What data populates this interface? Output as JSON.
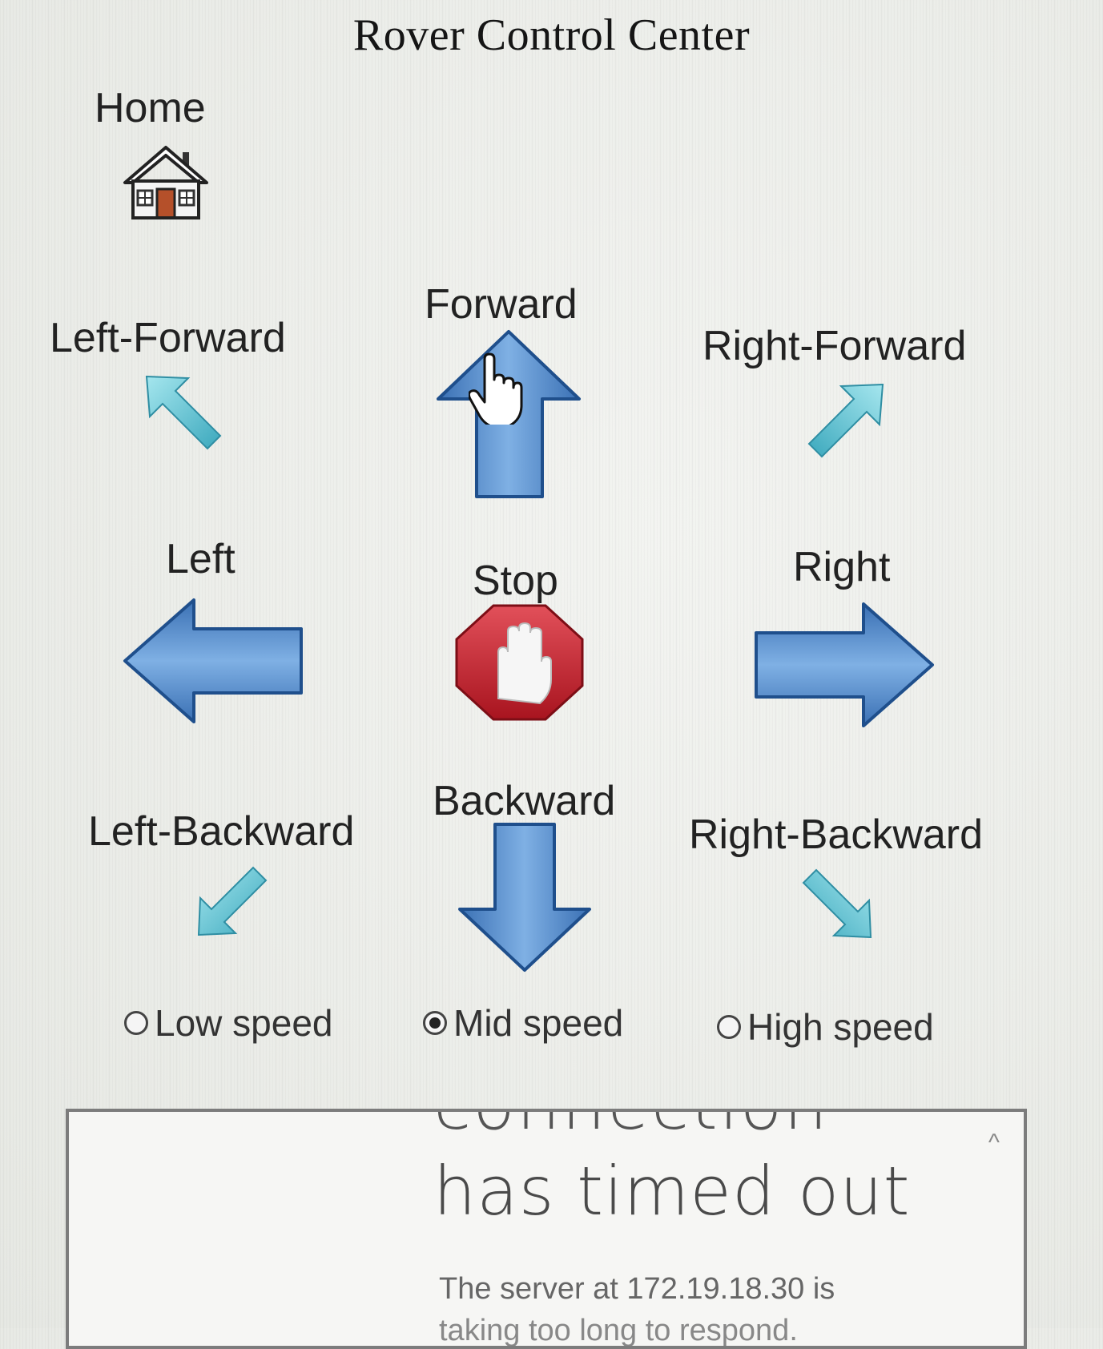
{
  "page": {
    "title": "Rover Control Center"
  },
  "controls": {
    "home": "Home",
    "forward": "Forward",
    "left_forward": "Left-Forward",
    "right_forward": "Right-Forward",
    "left": "Left",
    "stop": "Stop",
    "right": "Right",
    "backward": "Backward",
    "left_backward": "Left-Backward",
    "right_backward": "Right-Backward"
  },
  "speed": {
    "options": [
      "Low speed",
      "Mid speed",
      "High speed"
    ],
    "selected": "Mid speed"
  },
  "error": {
    "partial_heading": "connection",
    "heading": "has timed out",
    "message": "The server at 172.19.18.30 is",
    "message_cont": "taking too long to respond."
  },
  "colors": {
    "arrow_blue": "#4f86c6",
    "arrow_teal": "#5bc4d6",
    "stop_red": "#c8202e"
  },
  "icons": {
    "home": "house-icon",
    "cursor": "hand-pointer-icon",
    "stop": "stop-hand-icon",
    "collapse": "caret-up-icon"
  }
}
